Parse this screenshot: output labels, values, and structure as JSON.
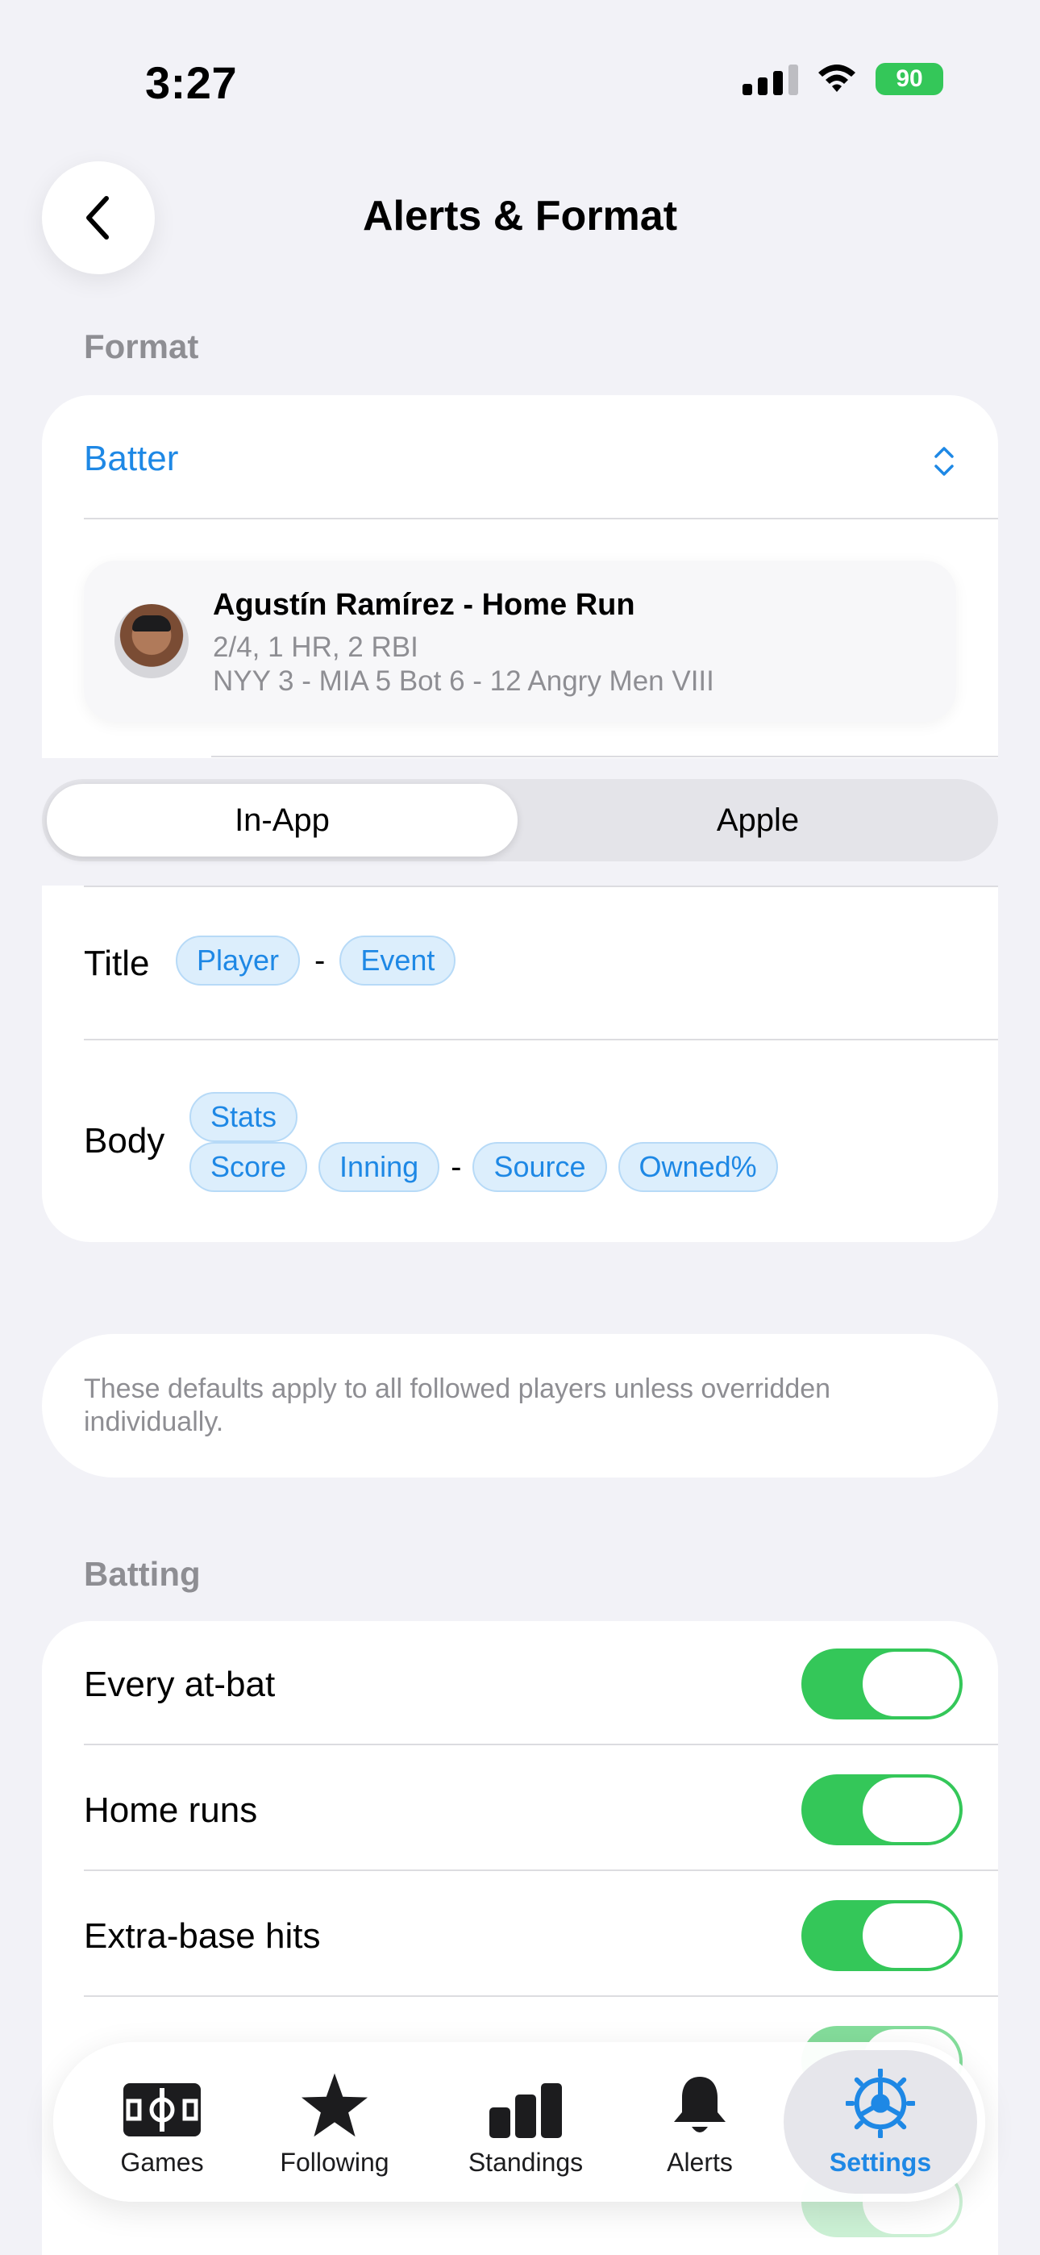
{
  "status_bar": {
    "time": "3:27",
    "battery": "90"
  },
  "header": {
    "title": "Alerts & Format"
  },
  "format_section": {
    "label": "Format",
    "selector": "Batter",
    "preview": {
      "title": "Agustín Ramírez - Home Run",
      "line1": "2/4, 1 HR, 2 RBI",
      "line2": "NYY 3 - MIA 5 Bot 6 - 12 Angry Men VIII"
    },
    "segments": {
      "active": "In-App",
      "inactive": "Apple"
    },
    "title_field": {
      "label": "Title",
      "chips": [
        "Player",
        "Event"
      ],
      "separator": "-"
    },
    "body_field": {
      "label": "Body",
      "row1": [
        "Stats"
      ],
      "row2a": [
        "Score",
        "Inning"
      ],
      "separator": "-",
      "row2b": [
        "Source",
        "Owned%"
      ]
    },
    "note": "These defaults apply to all followed players unless overridden individually."
  },
  "batting_section": {
    "label": "Batting",
    "rows": [
      {
        "label": "Every at-bat",
        "on": true
      },
      {
        "label": "Home runs",
        "on": true
      },
      {
        "label": "Extra-base hits",
        "on": true
      }
    ]
  },
  "tabbar": {
    "tabs": [
      {
        "label": "Games",
        "icon": "field-icon"
      },
      {
        "label": "Following",
        "icon": "star-icon"
      },
      {
        "label": "Standings",
        "icon": "bars-icon"
      },
      {
        "label": "Alerts",
        "icon": "bell-icon"
      },
      {
        "label": "Settings",
        "icon": "gear-icon"
      }
    ],
    "active": "Settings"
  },
  "colors": {
    "accent": "#1E88E5",
    "toggle_on": "#34C759",
    "background": "#F2F2F7"
  }
}
